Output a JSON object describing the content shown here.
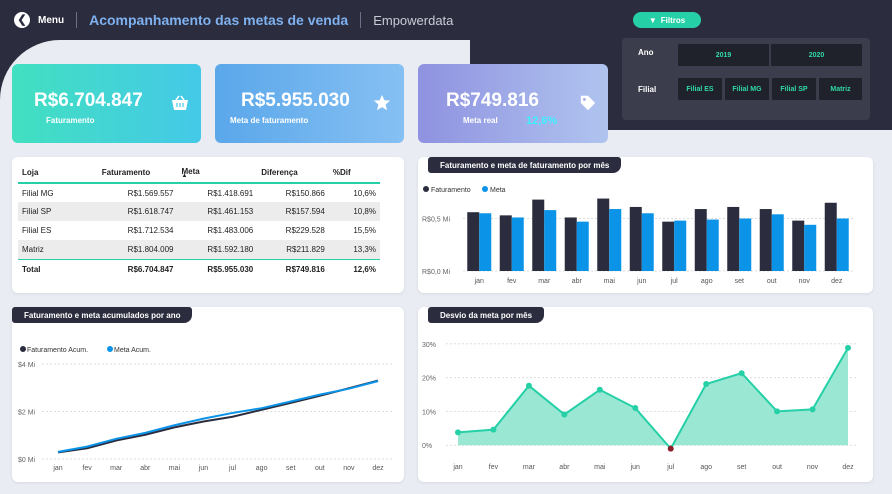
{
  "header": {
    "menu_label": "Menu",
    "title": "Acompanhamento das metas de venda",
    "brand": "Empowerdata"
  },
  "filters": {
    "button_label": "Filtros",
    "ano_label": "Ano",
    "anos": [
      "2019",
      "2020"
    ],
    "filial_label": "Filial",
    "filiais": [
      "Filial ES",
      "Filial MG",
      "Filial SP",
      "Matriz"
    ]
  },
  "kpis": [
    {
      "value": "R$6.704.847",
      "label": "Faturamento",
      "icon": "basket-icon",
      "grad": [
        "#42e0c0",
        "#44c9e8"
      ]
    },
    {
      "value": "R$5.955.030",
      "label": "Meta de faturamento",
      "icon": "star-icon",
      "grad": [
        "#5aa7ea",
        "#86c0f3"
      ]
    },
    {
      "value": "R$749.816",
      "label": "Meta real",
      "extra": "12,6%",
      "icon": "tag-icon",
      "grad": [
        "#8f92e0",
        "#b0c4ef"
      ]
    }
  ],
  "table": {
    "headers": [
      "Loja",
      "Faturamento",
      "Meta",
      "Diferença",
      "%Dif"
    ],
    "rows": [
      [
        "Filial MG",
        "R$1.569.557",
        "R$1.418.691",
        "R$150.866",
        "10,6%"
      ],
      [
        "Filial SP",
        "R$1.618.747",
        "R$1.461.153",
        "R$157.594",
        "10,8%"
      ],
      [
        "Filial ES",
        "R$1.712.534",
        "R$1.483.006",
        "R$229.528",
        "15,5%"
      ],
      [
        "Matriz",
        "R$1.804.009",
        "R$1.592.180",
        "R$211.829",
        "13,3%"
      ]
    ],
    "total": [
      "Total",
      "R$6.704.847",
      "R$5.955.030",
      "R$749.816",
      "12,6%"
    ]
  },
  "colors": {
    "dark": "#2b2d3e",
    "blue": "#0b93e8",
    "teal": "#26d0a7",
    "red": "#8b1e2b"
  },
  "chart_data": [
    {
      "type": "bar",
      "title": "Faturamento e meta de faturamento por mês",
      "categories": [
        "jan",
        "fev",
        "mar",
        "abr",
        "mai",
        "jun",
        "jul",
        "ago",
        "set",
        "out",
        "nov",
        "dez"
      ],
      "series": [
        {
          "name": "Faturamento",
          "values": [
            0.56,
            0.53,
            0.68,
            0.51,
            0.69,
            0.61,
            0.47,
            0.59,
            0.61,
            0.59,
            0.48,
            0.65
          ]
        },
        {
          "name": "Meta",
          "values": [
            0.55,
            0.51,
            0.58,
            0.47,
            0.59,
            0.55,
            0.48,
            0.49,
            0.5,
            0.54,
            0.44,
            0.5
          ]
        }
      ],
      "yticks": [
        "R$0,0 Mi",
        "R$0,5 Mi"
      ],
      "ylim": [
        0,
        0.8
      ],
      "legend": "top-left"
    },
    {
      "type": "line",
      "title": "Faturamento e meta acumulados por ano",
      "categories": [
        "jan",
        "fev",
        "mar",
        "abr",
        "mai",
        "jun",
        "jul",
        "ago",
        "set",
        "out",
        "nov",
        "dez"
      ],
      "series": [
        {
          "name": "Faturamento Acum.",
          "values": [
            0.28,
            0.45,
            0.78,
            1.02,
            1.33,
            1.58,
            1.78,
            2.07,
            2.36,
            2.66,
            2.98,
            3.3
          ]
        },
        {
          "name": "Meta Acum.",
          "values": [
            0.3,
            0.52,
            0.85,
            1.1,
            1.42,
            1.7,
            1.94,
            2.14,
            2.42,
            2.71,
            2.96,
            3.28
          ]
        }
      ],
      "yticks": [
        "$0 Mi",
        "$2 Mi",
        "$4 Mi"
      ],
      "ylim": [
        0,
        4
      ],
      "legend": "top-left"
    },
    {
      "type": "area",
      "title": "Desvio da meta por mês",
      "categories": [
        "jan",
        "fev",
        "mar",
        "abr",
        "mai",
        "jun",
        "jul",
        "ago",
        "set",
        "out",
        "nov",
        "dez"
      ],
      "values": [
        3.8,
        4.6,
        17.6,
        9.1,
        16.4,
        11.0,
        -1.0,
        18.1,
        21.3,
        10.0,
        10.6,
        28.8
      ],
      "yticks": [
        "0%",
        "10%",
        "20%",
        "30%"
      ],
      "ylim": [
        -2,
        32
      ]
    }
  ]
}
